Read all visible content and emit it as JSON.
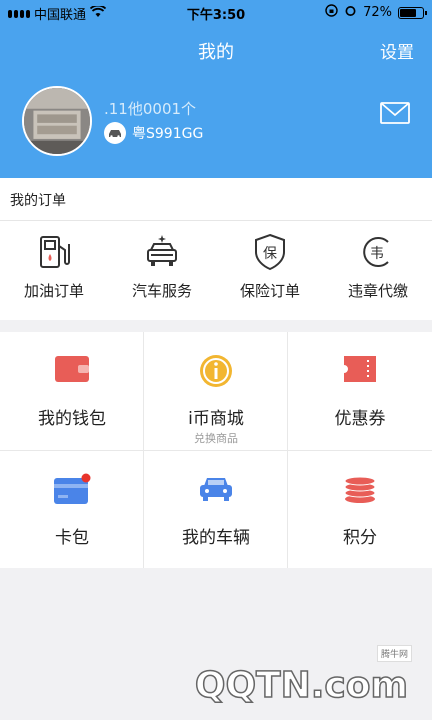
{
  "status_bar": {
    "carrier": "中国联通",
    "time": "下午3:50",
    "battery": "72%"
  },
  "header": {
    "title": "我的",
    "settings": "设置",
    "username": ".11他0001个",
    "plate": "粤S991GG"
  },
  "orders": {
    "title": "我的订单",
    "items": [
      {
        "label": "加油订单",
        "icon": "fuel-pump-icon"
      },
      {
        "label": "汽车服务",
        "icon": "car-wash-icon"
      },
      {
        "label": "保险订单",
        "icon": "insurance-shield-icon"
      },
      {
        "label": "违章代缴",
        "icon": "violation-payment-icon"
      }
    ]
  },
  "grid": {
    "items": [
      {
        "label": "我的钱包",
        "icon": "wallet-icon",
        "color": "#e85d57"
      },
      {
        "label": "i币商城",
        "sub": "兑换商品",
        "icon": "coin-icon",
        "color": "#f2b631"
      },
      {
        "label": "优惠券",
        "icon": "coupon-icon",
        "color": "#e85d57"
      },
      {
        "label": "卡包",
        "icon": "card-icon",
        "color": "#4a84e8"
      },
      {
        "label": "我的车辆",
        "icon": "car-icon",
        "color": "#4a84e8"
      },
      {
        "label": "积分",
        "icon": "points-coins-icon",
        "color": "#e85d57"
      }
    ]
  },
  "watermark": {
    "site": "腾牛网",
    "text": "QQTN.com"
  },
  "colors": {
    "primary": "#4aa3ee",
    "red": "#e85d57",
    "blue": "#4a84e8",
    "gold": "#f2b631"
  }
}
